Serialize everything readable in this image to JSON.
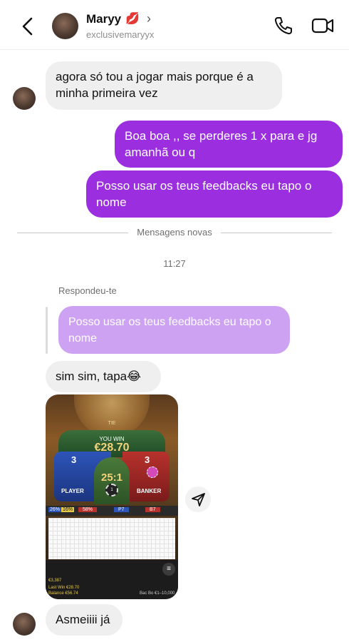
{
  "header": {
    "name": "Maryy",
    "emoji": "💋",
    "chevron": "›",
    "username": "exclusivemaryyx",
    "icons": [
      "back-arrow-icon",
      "phone-icon",
      "video-camera-icon"
    ]
  },
  "messages": {
    "m1": "agora só tou a jogar mais porque é a minha primeira vez",
    "m2": "Boa boa ,, se perderes 1 x para e jg amanhã ou q",
    "m3": "Posso usar os teus feedbacks eu tapo o nome",
    "divider": "Mensagens novas",
    "time": "11:27",
    "replied_label": "Respondeu-te",
    "quoted": "Posso usar os teus feedbacks eu tapo o nome",
    "m4": "sim sim, tapa😂",
    "m5": "Asmeiiii já"
  },
  "game": {
    "tie": "TIE",
    "you_win": "YOU WIN",
    "amount": "€28.70",
    "player_score": "3",
    "banker_score": "3",
    "odds": "25:1",
    "player_label": "PLAYER",
    "banker_label": "BANKER",
    "chip_value": "1",
    "stat_blue": "26%",
    "stat_yellow": "16%",
    "stat_red": "58%",
    "stat_p": "P7",
    "stat_b": "B7",
    "balance_top": "€3,387",
    "last_win": "Last Win €28.70",
    "balance": "Balance €56.74",
    "table": "Bac Bo €1–10,000"
  },
  "colors": {
    "outgoing_bubble": "#9b2fe0",
    "incoming_bubble": "#efefef",
    "quote_bubble": "#cda2f3"
  }
}
